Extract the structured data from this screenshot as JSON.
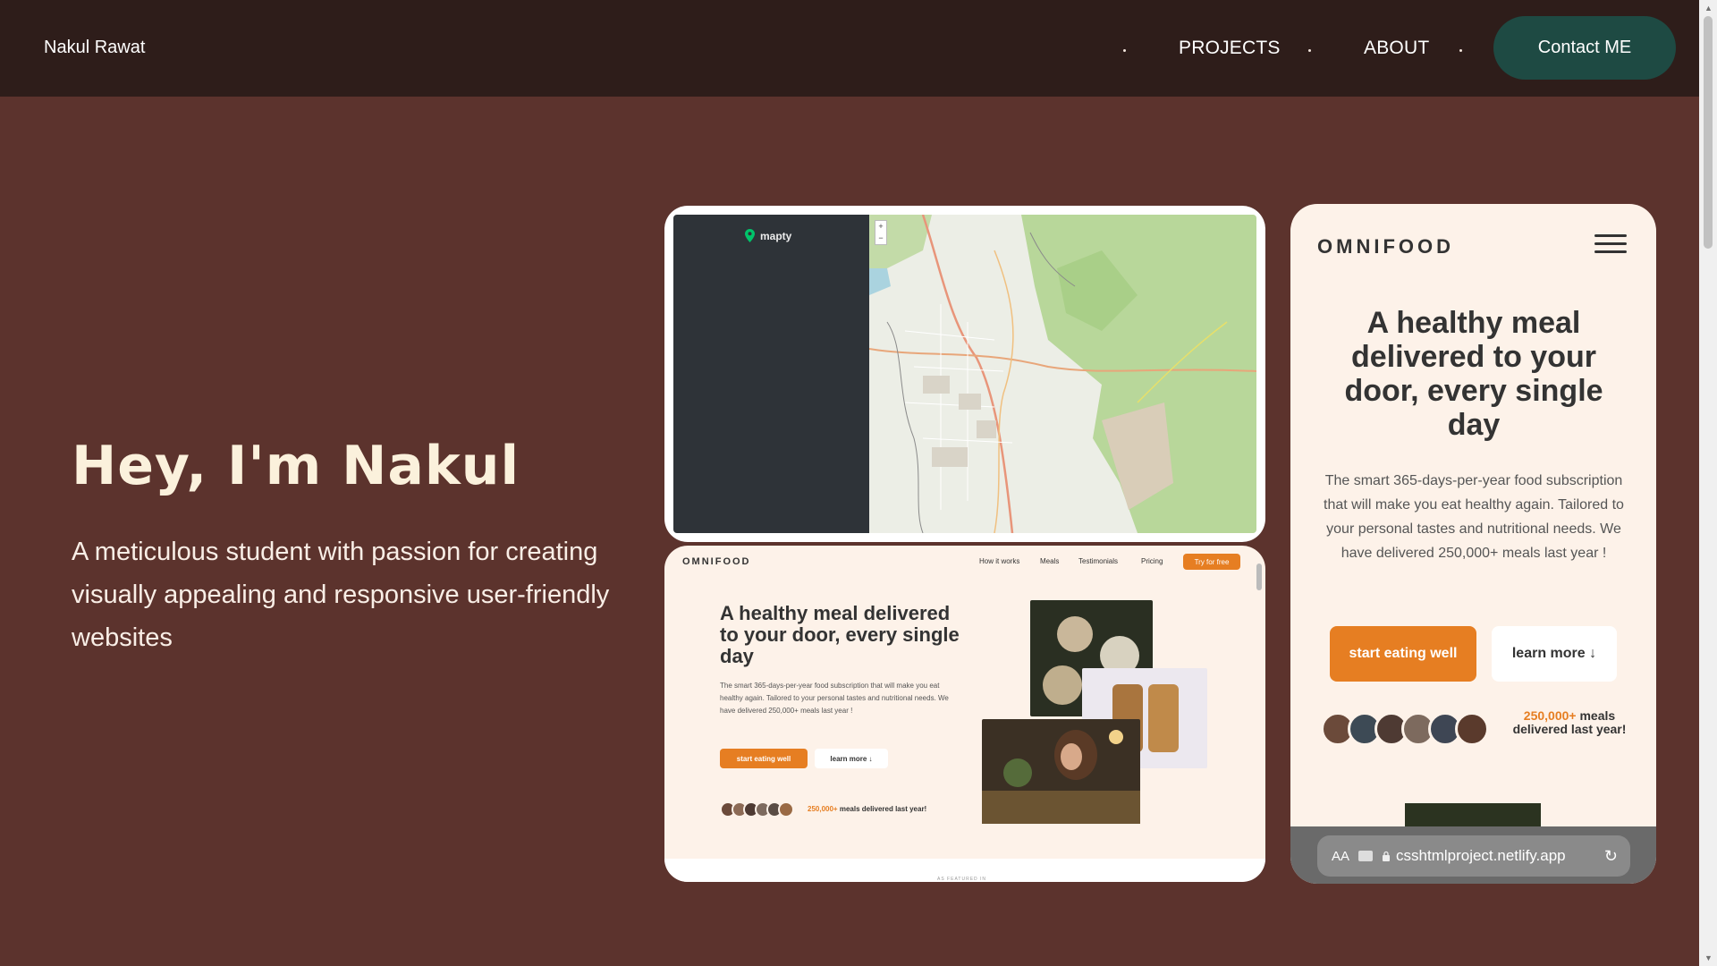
{
  "header": {
    "brand": "Nakul Rawat",
    "nav": [
      "PROJECTS",
      "ABOUT"
    ],
    "contact_label": "Contact ME"
  },
  "hero": {
    "title": "Hey, I'm Nakul",
    "subtitle": "A meticulous student with passion for creating visually appealing and responsive user-friendly websites"
  },
  "mapty_card": {
    "logo_text": "mapty",
    "zoom_in": "+",
    "zoom_out": "−"
  },
  "omnifood_desktop": {
    "logo": "OMNIFOOD",
    "nav": [
      "How it works",
      "Meals",
      "Testimonials",
      "Pricing"
    ],
    "cta": "Try for free",
    "headline": "A healthy meal delivered to your door, every single day",
    "description": "The smart 365-days-per-year food subscription that will make you eat healthy again. Tailored to your personal tastes and nutritional needs. We have delivered 250,000+ meals last year !",
    "primary_btn": "start eating well",
    "secondary_btn": "learn more ↓",
    "meals_count": "250,000+",
    "meals_text": "meals delivered last year!",
    "footer_label": "AS FEATURED IN"
  },
  "omnifood_mobile": {
    "logo": "OMNIFOOD",
    "headline": "A healthy meal delivered to your door, every single day",
    "description": "The smart 365-days-per-year food subscription that will make you eat healthy again. Tailored to your personal tastes and nutritional needs. We have delivered 250,000+ meals last year !",
    "primary_btn": "start eating well",
    "secondary_btn": "learn more ↓",
    "meals_count": "250,000+",
    "meals_text": "meals delivered last year!",
    "url_aa": "AA",
    "url": "csshtmlproject.netlify.app",
    "reload_icon": "↻"
  },
  "colors": {
    "page_bg": "#5c332d",
    "header_bg": "#2e1d1a",
    "contact_bg": "#1e4a43",
    "hero_title": "#fbf1dc",
    "omnifood_orange": "#e67e22",
    "omnifood_bg": "#fdf2e9"
  }
}
